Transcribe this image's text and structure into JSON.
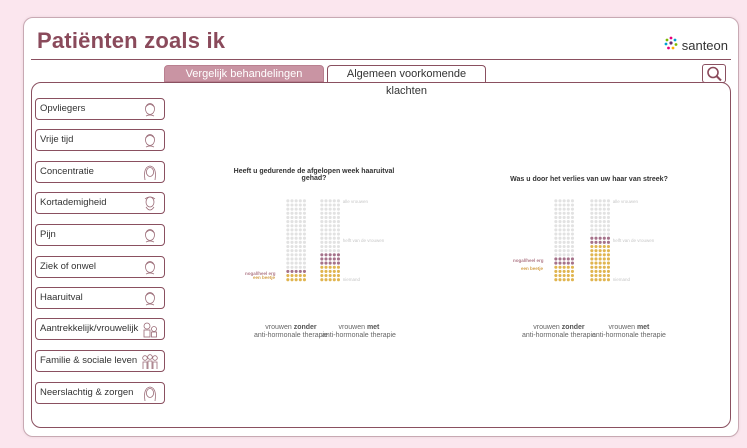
{
  "app_title": "Patiënten zoals ik",
  "logo": {
    "name": "santeon",
    "icon": "santeon-logo-icon"
  },
  "tabs": [
    {
      "label": "Vergelijk behandelingen",
      "active": true
    },
    {
      "label": "Algemeen voorkomende klachten",
      "active": false
    }
  ],
  "search": {
    "icon": "search-icon"
  },
  "sidebar": {
    "items": [
      {
        "label": "Opvliegers",
        "icon": "face-icon"
      },
      {
        "label": "Vrije tijd",
        "icon": "face-icon"
      },
      {
        "label": "Concentratie",
        "icon": "face-long-hair-icon"
      },
      {
        "label": "Kortademigheid",
        "icon": "face-breathing-icon"
      },
      {
        "label": "Pijn",
        "icon": "face-icon"
      },
      {
        "label": "Ziek of onwel",
        "icon": "face-icon"
      },
      {
        "label": "Haaruitval",
        "icon": "face-icon"
      },
      {
        "label": "Aantrekkelijk/vrouwelijk",
        "icon": "people-icon"
      },
      {
        "label": "Familie & sociale leven",
        "icon": "family-icon"
      },
      {
        "label": "Neerslachtig & zorgen",
        "icon": "face-long-hair-icon"
      }
    ]
  },
  "colors": {
    "accent": "#8a4a5b",
    "tab_active": "#c994a3",
    "dot_grey": "#e2e2e2",
    "dot_erg": "#a5728a",
    "dot_beetje": "#e0b550"
  },
  "charts": [
    {
      "title": "Heeft u gedurende de afgelopen week haaruitval gehad?",
      "ref_labels": {
        "alle": "alle vrouwen",
        "helft": "helft van de vrouwen",
        "niemand": "niemand"
      },
      "cat_labels": {
        "erg": "nogal/heel erg",
        "beetje": "een beetje"
      },
      "groups": [
        {
          "label_pre": "vrouwen ",
          "label_bold": "zonder",
          "label_sub": "anti-hormonale therapie",
          "erg": 5,
          "beetje": 10,
          "total": 100
        },
        {
          "label_pre": "vrouwen ",
          "label_bold": "met",
          "label_sub": "anti-hormonale therapie",
          "erg": 15,
          "beetje": 20,
          "total": 100
        }
      ]
    },
    {
      "title": "Was u door het verlies van uw haar van streek?",
      "ref_labels": {
        "alle": "alle vrouwen",
        "helft": "helft van de vrouwen",
        "niemand": "niemand"
      },
      "cat_labels": {
        "erg": "nogal/heel erg",
        "beetje": "een beetje"
      },
      "groups": [
        {
          "label_pre": "vrouwen ",
          "label_bold": "zonder",
          "label_sub": "anti-hormonale therapie",
          "erg": 10,
          "beetje": 20,
          "total": 100
        },
        {
          "label_pre": "vrouwen ",
          "label_bold": "met",
          "label_sub": "anti-hormonale therapie",
          "erg": 10,
          "beetje": 45,
          "total": 100
        }
      ]
    }
  ]
}
